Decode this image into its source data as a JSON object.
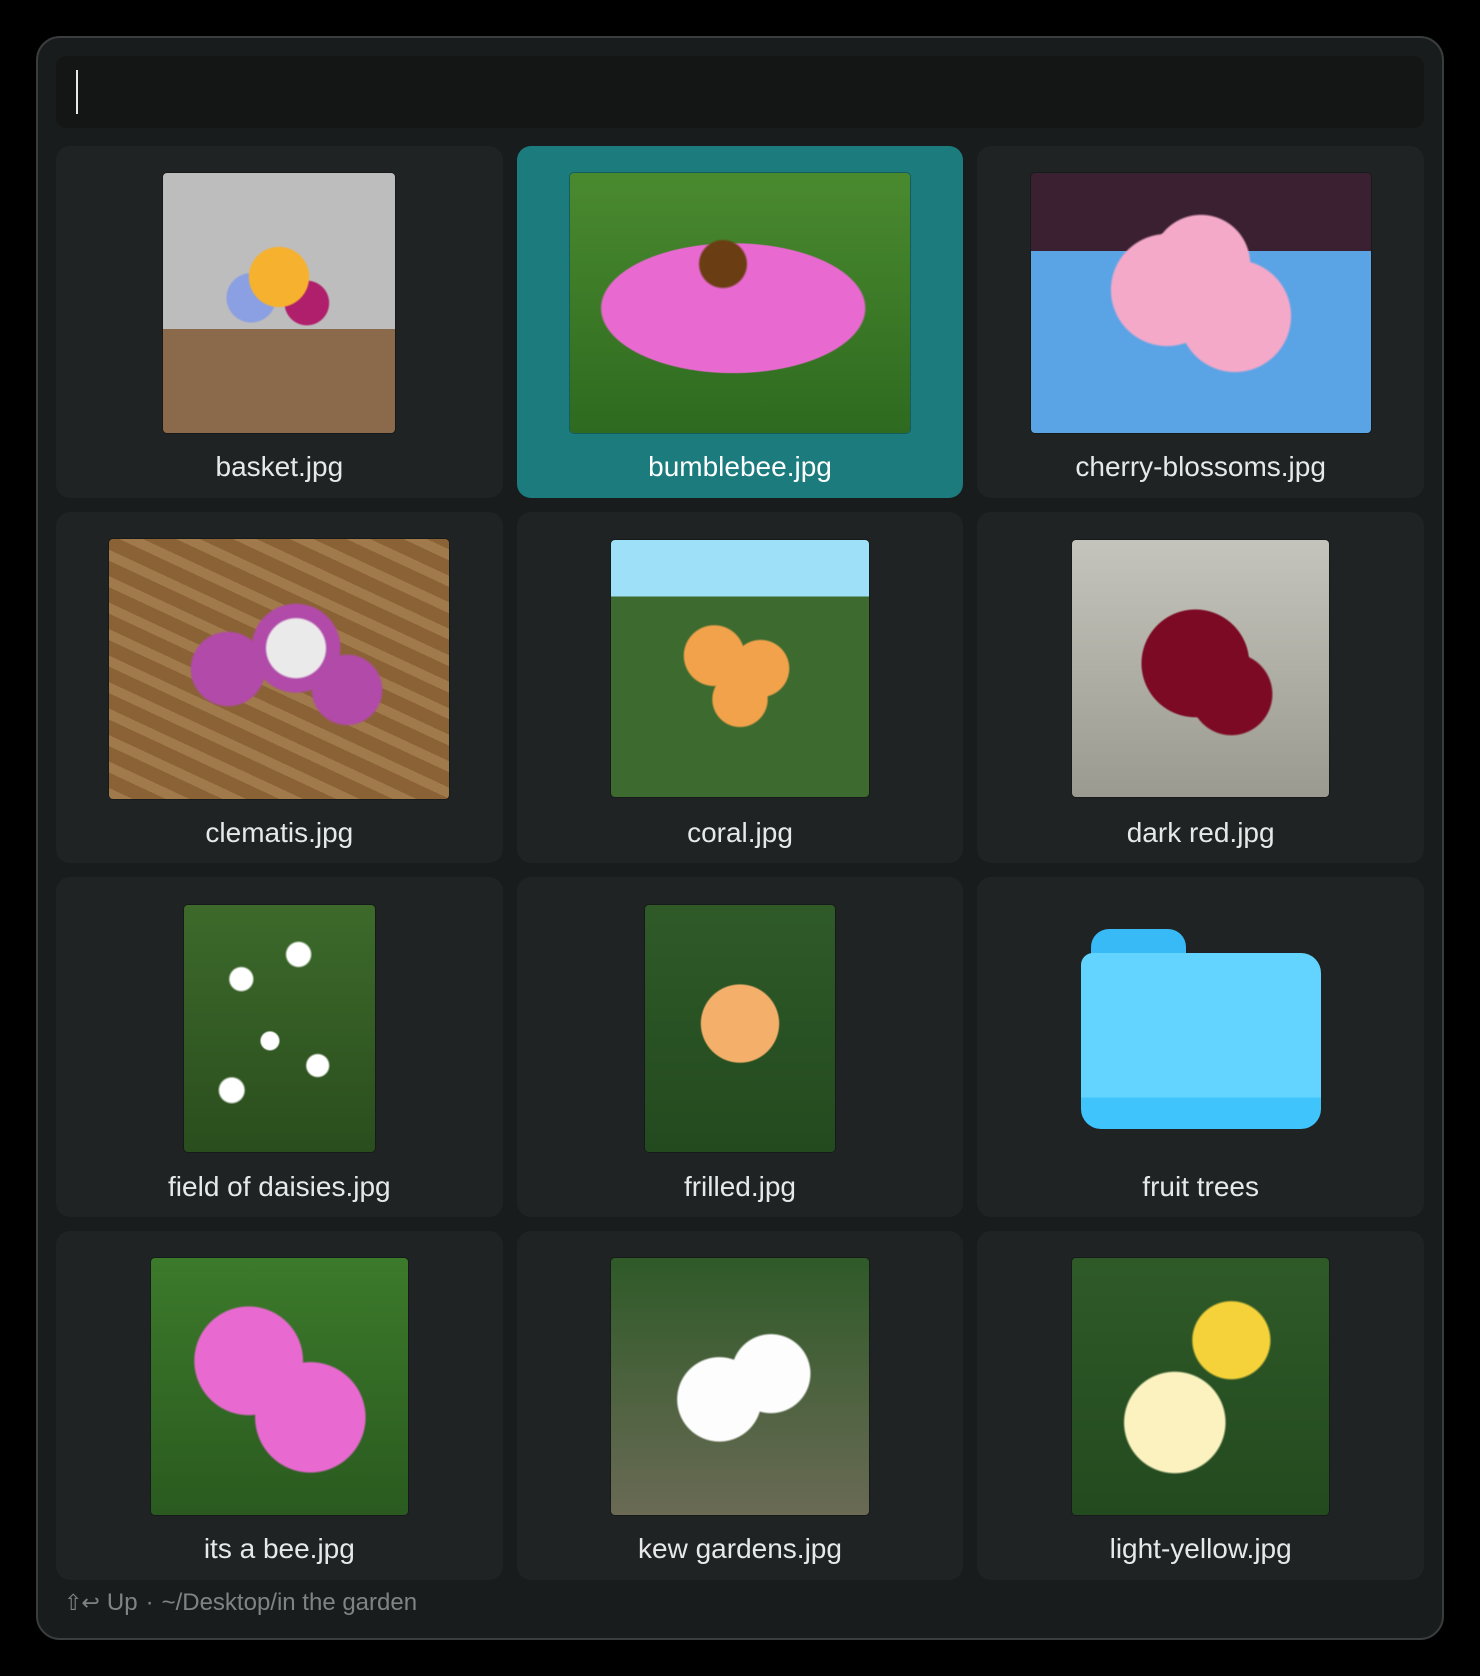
{
  "search": {
    "value": "",
    "placeholder": ""
  },
  "status": {
    "glyph": "⇧↩",
    "action": "Up",
    "separator": "·",
    "path": "~/Desktop/in the garden"
  },
  "items": [
    {
      "name": "basket.jpg",
      "type": "image",
      "selected": false
    },
    {
      "name": "bumblebee.jpg",
      "type": "image",
      "selected": true
    },
    {
      "name": "cherry-blossoms.jpg",
      "type": "image",
      "selected": false
    },
    {
      "name": "clematis.jpg",
      "type": "image",
      "selected": false
    },
    {
      "name": "coral.jpg",
      "type": "image",
      "selected": false
    },
    {
      "name": "dark red.jpg",
      "type": "image",
      "selected": false
    },
    {
      "name": "field of daisies.jpg",
      "type": "image",
      "selected": false
    },
    {
      "name": "frilled.jpg",
      "type": "image",
      "selected": false
    },
    {
      "name": "fruit trees",
      "type": "folder",
      "selected": false
    },
    {
      "name": "its a bee.jpg",
      "type": "image",
      "selected": false
    },
    {
      "name": "kew gardens.jpg",
      "type": "image",
      "selected": false
    },
    {
      "name": "light-yellow.jpg",
      "type": "image",
      "selected": false
    }
  ]
}
